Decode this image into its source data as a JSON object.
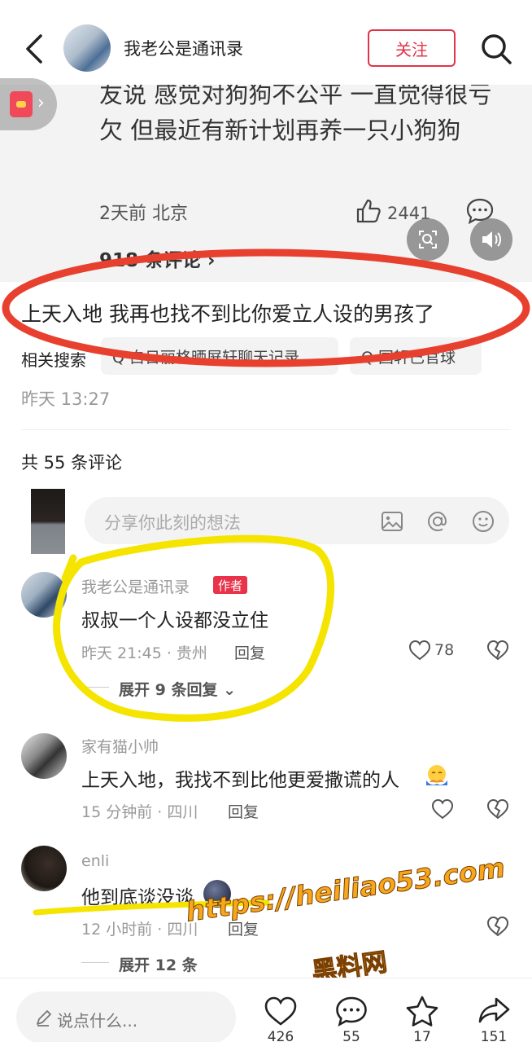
{
  "header": {
    "username": "我老公是通讯录",
    "follow_label": "关注"
  },
  "quote_card": {
    "text": "友说 感觉对狗狗不公平 一直觉得很亏欠 但最近有新计划再养一只小狗狗",
    "meta": "2天前 北京",
    "likes": "2441",
    "comments_link": "918 条评论 ›"
  },
  "post": {
    "body": "上天入地 我再也找不到比你爱立人设的男孩了",
    "related_label": "相关搜索",
    "chips": [
      "Q 白日丽格晒屏轩聊天记录",
      "Q 国轩已官球"
    ],
    "time": "昨天 13:27"
  },
  "comments_section": {
    "total": "共 55 条评论",
    "input_placeholder": "分享你此刻的想法"
  },
  "comments": [
    {
      "name": "我老公是通讯录",
      "badge": "作者",
      "text": "叔叔一个人设都没立住",
      "meta": "昨天 21:45 · 贵州",
      "reply": "回复",
      "likes": "78",
      "expand": "展开 9 条回复"
    },
    {
      "name": "家有猫小帅",
      "text": "上天入地，我找不到比他更爱撒谎的人",
      "meta": "15 分钟前 · 四川",
      "reply": "回复"
    },
    {
      "name": "enli",
      "text": "他到底谈没谈",
      "meta": "12 小时前 · 四川",
      "reply": "回复",
      "expand": "展开 12 条"
    }
  ],
  "bottom_bar": {
    "placeholder": "说点什么...",
    "likes": "426",
    "comments": "55",
    "stars": "17",
    "shares": "151"
  },
  "watermark": {
    "url": "https://heiliao53.com",
    "name": "黑料网"
  },
  "colors": {
    "accent": "#e3334a",
    "card_bg": "#f3f3f4",
    "annotation_red": "#e8402e",
    "annotation_yellow": "#f5e400",
    "watermark": "#f7a71b"
  },
  "icons": [
    "back-icon",
    "search-icon",
    "like-icon",
    "chat-icon",
    "lens-icon",
    "sound-icon",
    "image-icon",
    "at-icon",
    "emoji-icon",
    "heart-icon",
    "dislike-icon",
    "pencil-icon",
    "star-icon",
    "share-icon"
  ]
}
